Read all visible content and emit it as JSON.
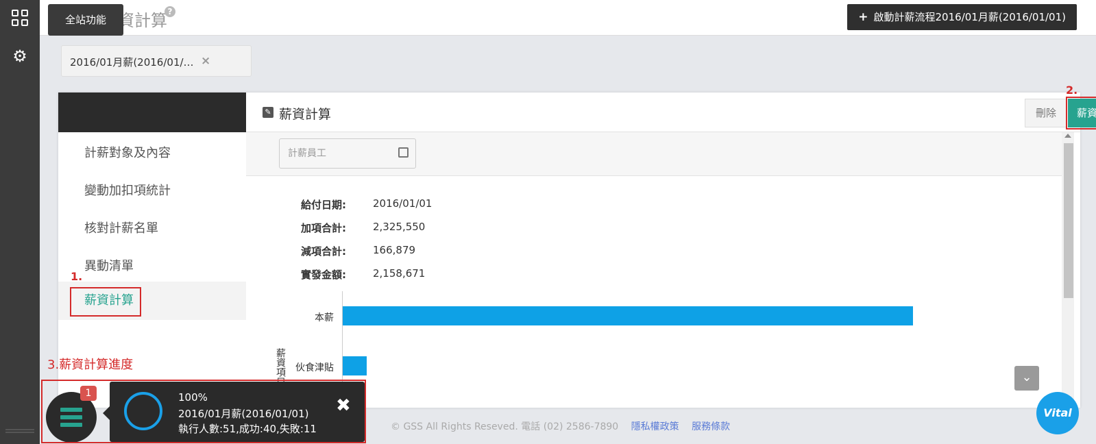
{
  "header": {
    "title": "薪資計算",
    "tooltip": "全站功能",
    "start_button_label": "啟動計薪流程2016/01月薪(2016/01/01)"
  },
  "tab_chip": {
    "label": "2016/01月薪(2016/01/…"
  },
  "card": {
    "page_title": "薪資計算",
    "delete_label": "刪除",
    "calc_label": "薪資計算",
    "step2_label": "2."
  },
  "nav": {
    "items": [
      {
        "label": "計薪對象及內容"
      },
      {
        "label": "變動加扣項統計"
      },
      {
        "label": "核對計薪名單"
      },
      {
        "label": "異動清單"
      },
      {
        "label": "薪資計算"
      }
    ],
    "step1_label": "1.",
    "step3_label": "3.薪資計算進度"
  },
  "content": {
    "employee_filter": "計薪員工",
    "summary": [
      {
        "key": "給付日期:",
        "value": "2016/01/01"
      },
      {
        "key": "加項合計:",
        "value": "2,325,550"
      },
      {
        "key": "減項合計:",
        "value": "166,879"
      },
      {
        "key": "實發金額:",
        "value": "2,158,671"
      }
    ]
  },
  "chart_data": {
    "type": "bar",
    "orientation": "horizontal",
    "categories": [
      "本薪",
      "伙食津貼"
    ],
    "values": [
      2000000,
      85000
    ],
    "ylabel": "薪資項目"
  },
  "notice": {
    "badge_count": "1",
    "percent": "100%",
    "job": "2016/01月薪(2016/01/01)",
    "stats": "執行人數:51,成功:40,失敗:11",
    "close_symbol": "✖"
  },
  "footer": {
    "copyright": "© GSS All Rights Reseved. 電話 (02) 2586-7890",
    "privacy": "隱私權政策",
    "terms": "服務條款"
  },
  "vital_label": "Vital",
  "colors": {
    "accent": "#27a38f",
    "annotation": "#d42a2a",
    "bar": "#0ea1e6"
  }
}
